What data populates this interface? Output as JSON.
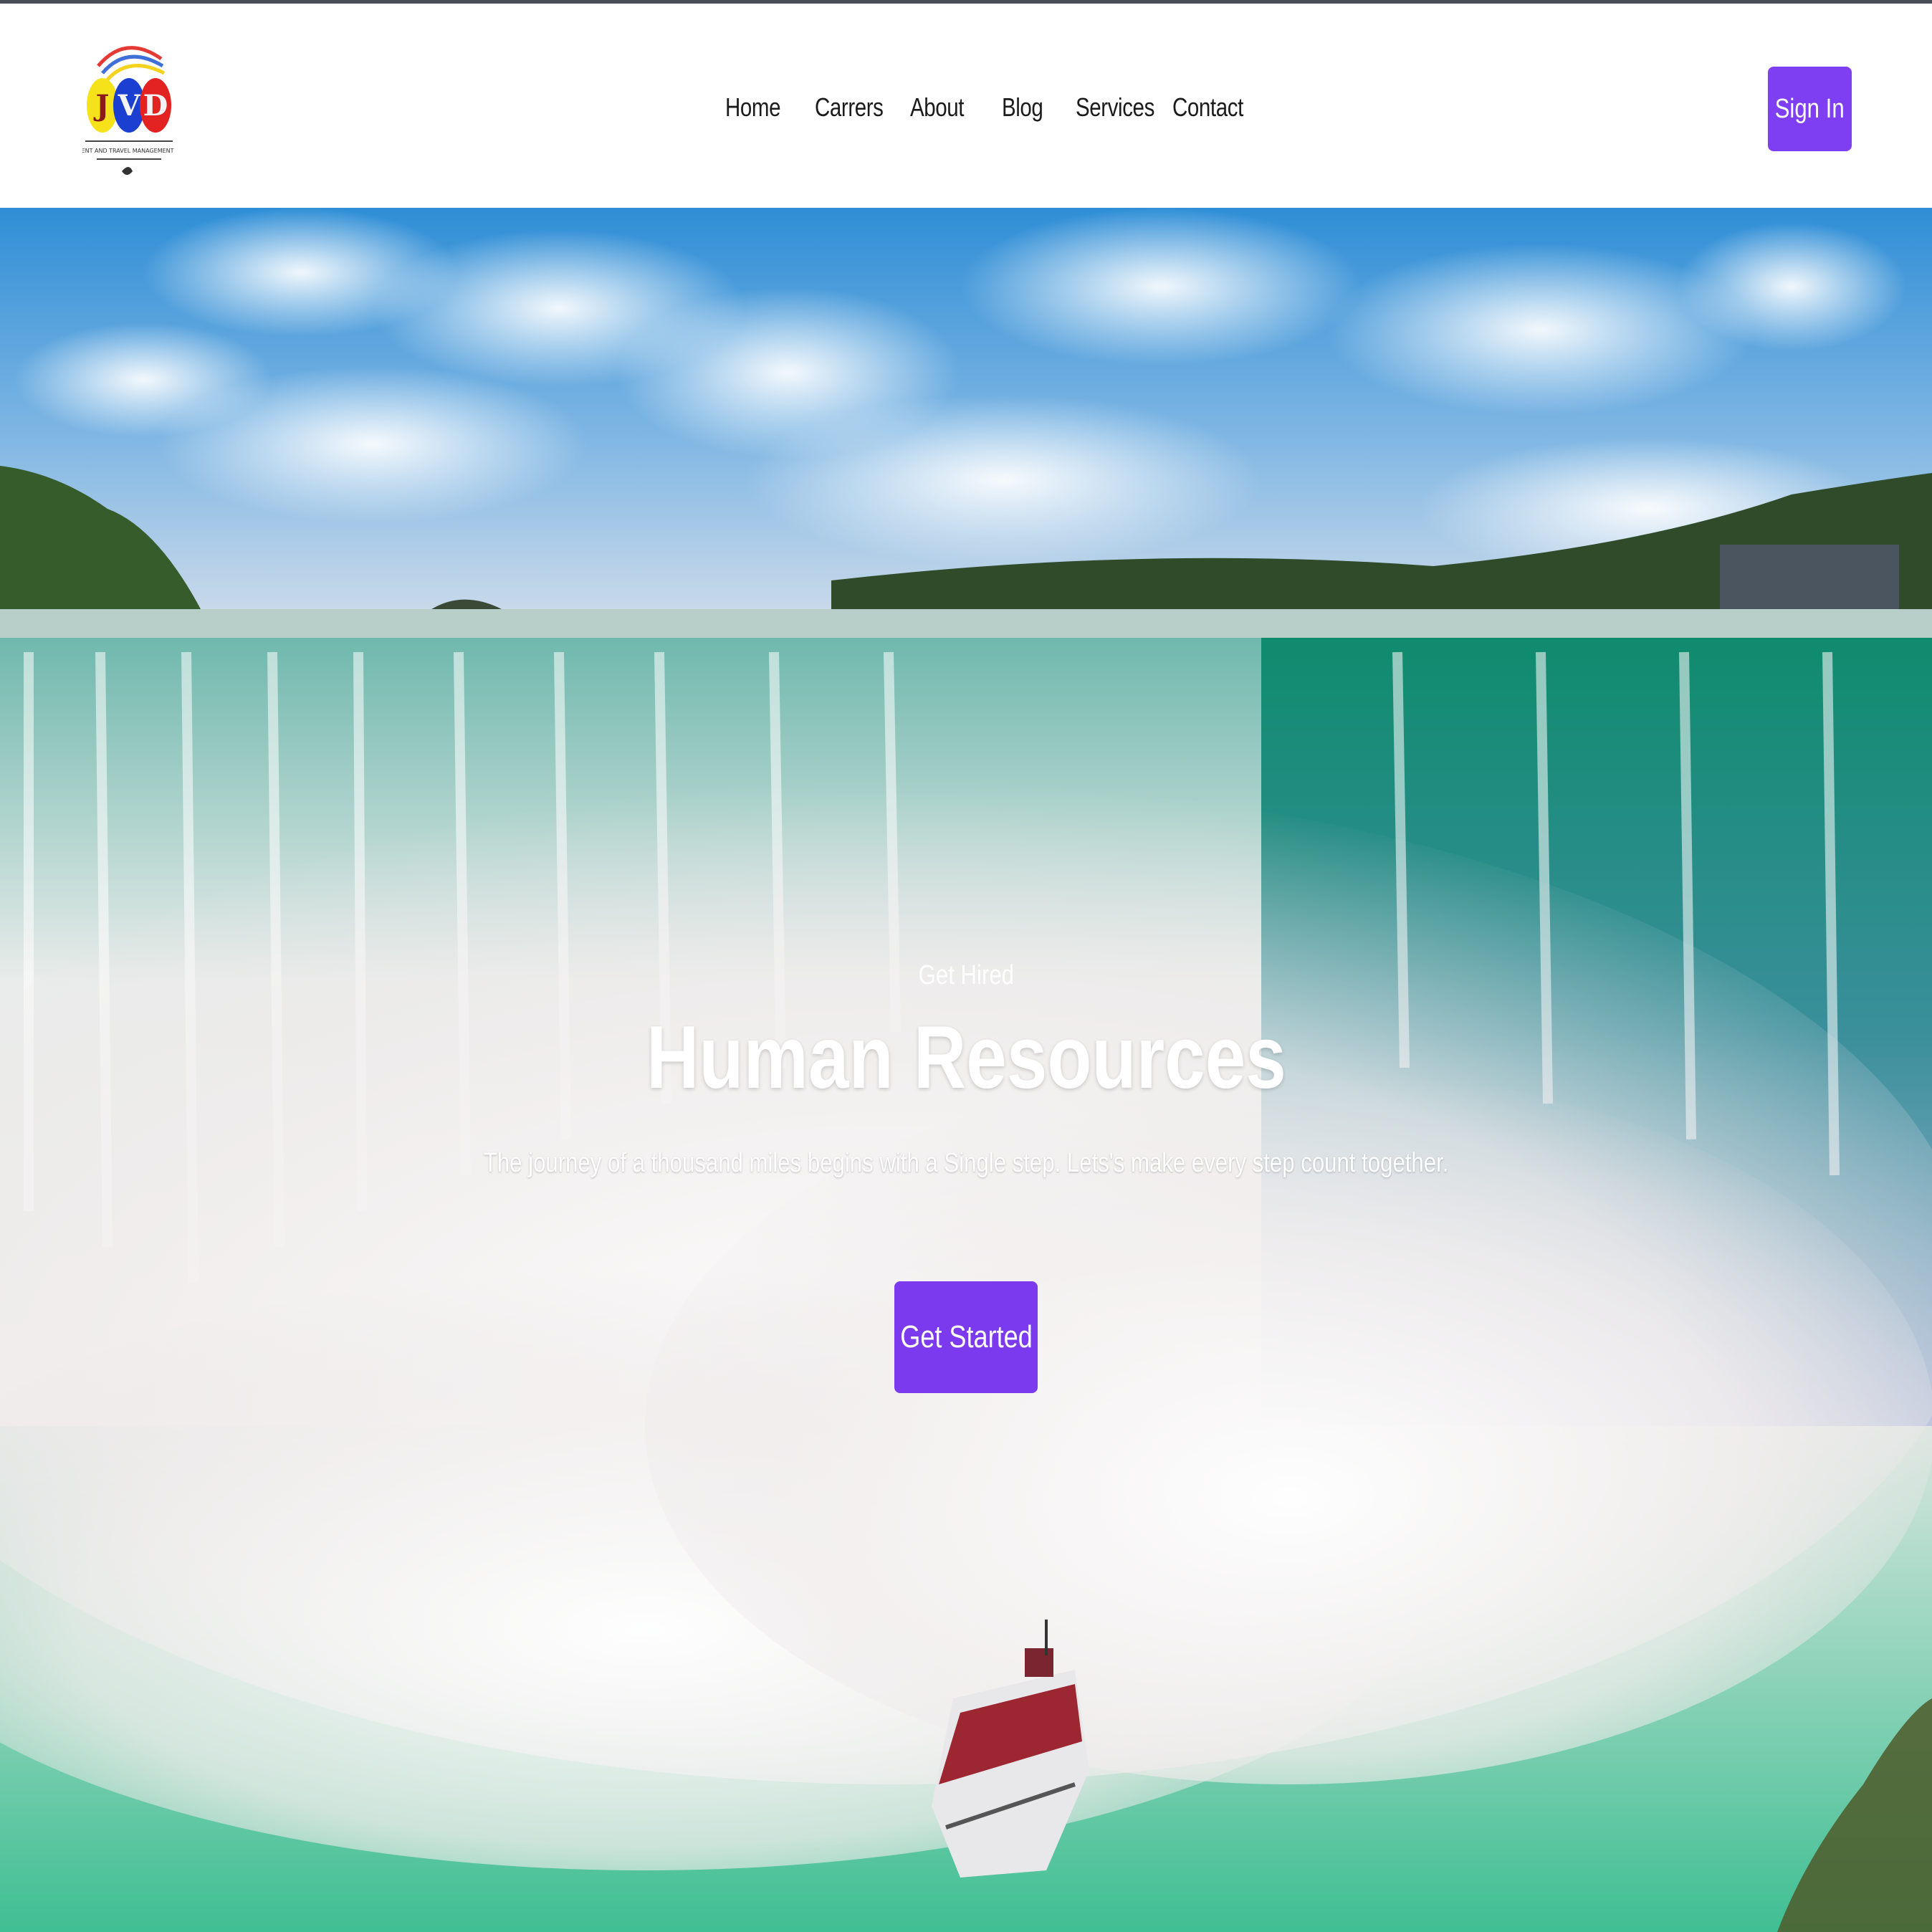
{
  "header": {
    "logo": {
      "letters": "JVD",
      "tagline": "EVENT AND TRAVEL MANAGEMENT CO"
    },
    "nav": [
      {
        "label": "Home"
      },
      {
        "label": "Carrers"
      },
      {
        "label": "About"
      },
      {
        "label": "Blog"
      },
      {
        "label": "Services"
      },
      {
        "label": "Contact"
      }
    ],
    "sign_in_label": "Sign In"
  },
  "hero": {
    "kicker": "Get Hired",
    "title": "Human Resources",
    "subtitle": "The journey of a thousand miles begins with a Single step. Lets's make every step count together.",
    "cta_label": "Get Started",
    "background": "waterfall-photo"
  },
  "colors": {
    "accent": "#7e3ff2",
    "topline": "#4a4d57",
    "nav_text": "#1b1b1b"
  }
}
